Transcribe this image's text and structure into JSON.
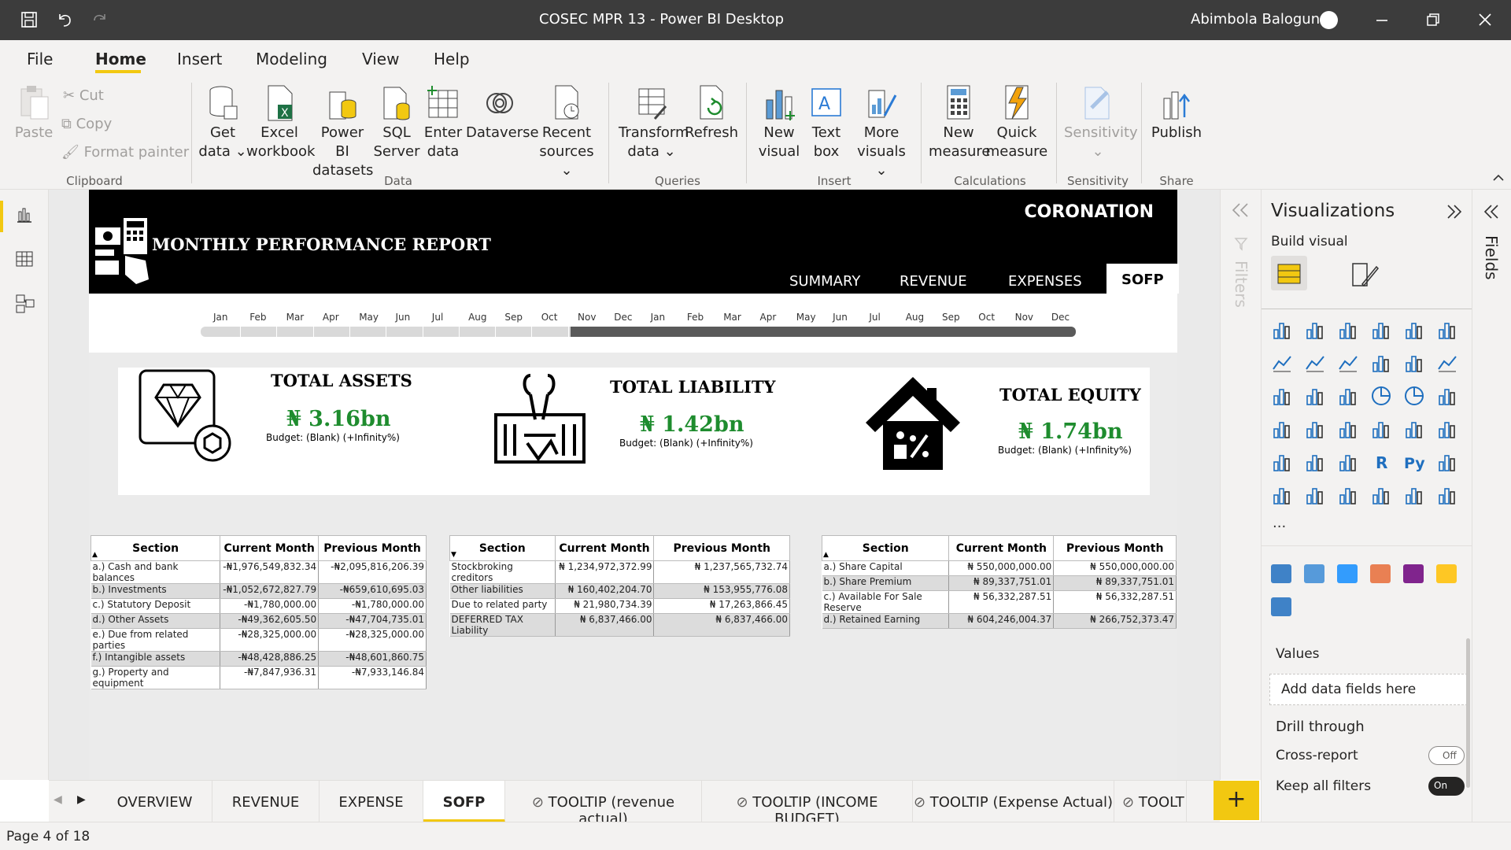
{
  "window": {
    "title": "COSEC MPR 13 - Power BI Desktop",
    "user": "Abimbola Balogun"
  },
  "menu": {
    "tabs": [
      "File",
      "Home",
      "Insert",
      "Modeling",
      "View",
      "Help"
    ],
    "active": "Home"
  },
  "ribbon": {
    "clipboard": {
      "paste": "Paste",
      "cut": "Cut",
      "copy": "Copy",
      "format_painter": "Format painter",
      "group": "Clipboard"
    },
    "data": {
      "get_data": [
        "Get",
        "data"
      ],
      "excel": [
        "Excel",
        "workbook"
      ],
      "pbi_datasets": [
        "Power BI",
        "datasets"
      ],
      "sql": [
        "SQL",
        "Server"
      ],
      "enter_data": [
        "Enter",
        "data"
      ],
      "dataverse": [
        "Dataverse"
      ],
      "recent": [
        "Recent",
        "sources"
      ],
      "group": "Data"
    },
    "queries": {
      "transform": [
        "Transform",
        "data"
      ],
      "refresh": [
        "Refresh"
      ],
      "group": "Queries"
    },
    "insert": {
      "new_visual": [
        "New",
        "visual"
      ],
      "text_box": [
        "Text",
        "box"
      ],
      "more_visuals": [
        "More",
        "visuals"
      ],
      "group": "Insert"
    },
    "calculations": {
      "new_measure": [
        "New",
        "measure"
      ],
      "quick_measure": [
        "Quick",
        "measure"
      ],
      "group": "Calculations"
    },
    "sensitivity": {
      "label": "Sensitivity",
      "group": "Sensitivity"
    },
    "share": {
      "publish": "Publish",
      "group": "Share"
    }
  },
  "report": {
    "title": "MONTHLY PERFORMANCE REPORT",
    "brand": "CORONATION",
    "nav": [
      "SUMMARY",
      "REVENUE",
      "EXPENSES",
      "SOFP"
    ],
    "nav_selected": "SOFP",
    "slicer_months": [
      "Jan",
      "Feb",
      "Mar",
      "Apr",
      "May",
      "Jun",
      "Jul",
      "Aug",
      "Sep",
      "Oct",
      "Nov",
      "Dec",
      "Jan",
      "Feb",
      "Mar",
      "Apr",
      "May",
      "Jun",
      "Jul",
      "Aug",
      "Sep",
      "Oct",
      "Nov",
      "Dec"
    ],
    "cards": [
      {
        "title": "TOTAL ASSETS",
        "value": "₦ 3.16bn",
        "budget": "Budget: (Blank) (+Infinity%)"
      },
      {
        "title": "TOTAL LIABILITY",
        "value": "₦ 1.42bn",
        "budget": "Budget: (Blank) (+Infinity%)"
      },
      {
        "title": "TOTAL EQUITY",
        "value": "₦ 1.74bn",
        "budget": "Budget: (Blank) (+Infinity%)"
      }
    ],
    "tables": {
      "headers": [
        "Section",
        "Current Month",
        "Previous Month"
      ],
      "assets": [
        [
          "a.) Cash and bank balances",
          "-₦1,976,549,832.34",
          "-₦2,095,816,206.39"
        ],
        [
          "b.) Investments",
          "-₦1,052,672,827.79",
          "-₦659,610,695.03"
        ],
        [
          "c.) Statutory Deposit",
          "-₦1,780,000.00",
          "-₦1,780,000.00"
        ],
        [
          "d.) Other Assets",
          "-₦49,362,605.50",
          "-₦47,704,735.01"
        ],
        [
          "e.) Due from related parties",
          "-₦28,325,000.00",
          "-₦28,325,000.00"
        ],
        [
          "f.) Intangible assets",
          "-₦48,428,886.25",
          "-₦48,601,860.75"
        ],
        [
          "g.) Property and equipment",
          "-₦7,847,936.31",
          "-₦7,933,146.84"
        ]
      ],
      "liabilities": [
        [
          "Stockbroking creditors",
          "₦ 1,234,972,372.99",
          "₦ 1,237,565,732.74"
        ],
        [
          "Other liabilities",
          "₦ 160,402,204.70",
          "₦ 153,955,776.08"
        ],
        [
          "Due to related party",
          "₦ 21,980,734.39",
          "₦ 17,263,866.45"
        ],
        [
          "DEFERRED TAX Liability",
          "₦ 6,837,466.00",
          "₦ 6,837,466.00"
        ]
      ],
      "equity": [
        [
          "a.) Share Capital",
          "₦ 550,000,000.00",
          "₦ 550,000,000.00"
        ],
        [
          "b.) Share Premium",
          "₦ 89,337,751.01",
          "₦ 89,337,751.01"
        ],
        [
          "c.) Available For Sale Reserve",
          "₦ 56,332,287.51",
          "₦ 56,332,287.51"
        ],
        [
          "d.) Retained Earning",
          "₦ 604,246,004.37",
          "₦ 266,752,373.47"
        ]
      ]
    }
  },
  "panes": {
    "filters_label": "Filters",
    "viz_title": "Visualizations",
    "build_visual": "Build visual",
    "fields_label": "Fields",
    "values_label": "Values",
    "add_fields": "Add data fields here",
    "drill_through": "Drill through",
    "cross_report": "Cross-report",
    "cross_report_state": "Off",
    "keep_filters": "Keep all filters",
    "keep_filters_state": "On",
    "viz_r": "R",
    "viz_py": "Py",
    "viz_ellipsis": "···"
  },
  "page_tabs": [
    "OVERVIEW",
    "REVENUE",
    "EXPENSE",
    "SOFP",
    "TOOLTIP (revenue actual)",
    "TOOLTIP (INCOME BUDGET)",
    "TOOLTIP (Expense Actual)",
    "TOOLT"
  ],
  "page_tab_selected": "SOFP",
  "status": "Page 4 of 18",
  "colors": {
    "accent": "#f2c811",
    "value_green": "#1e8c2e",
    "header_bg": "#000000",
    "titlebar": "#3c3c3c"
  }
}
